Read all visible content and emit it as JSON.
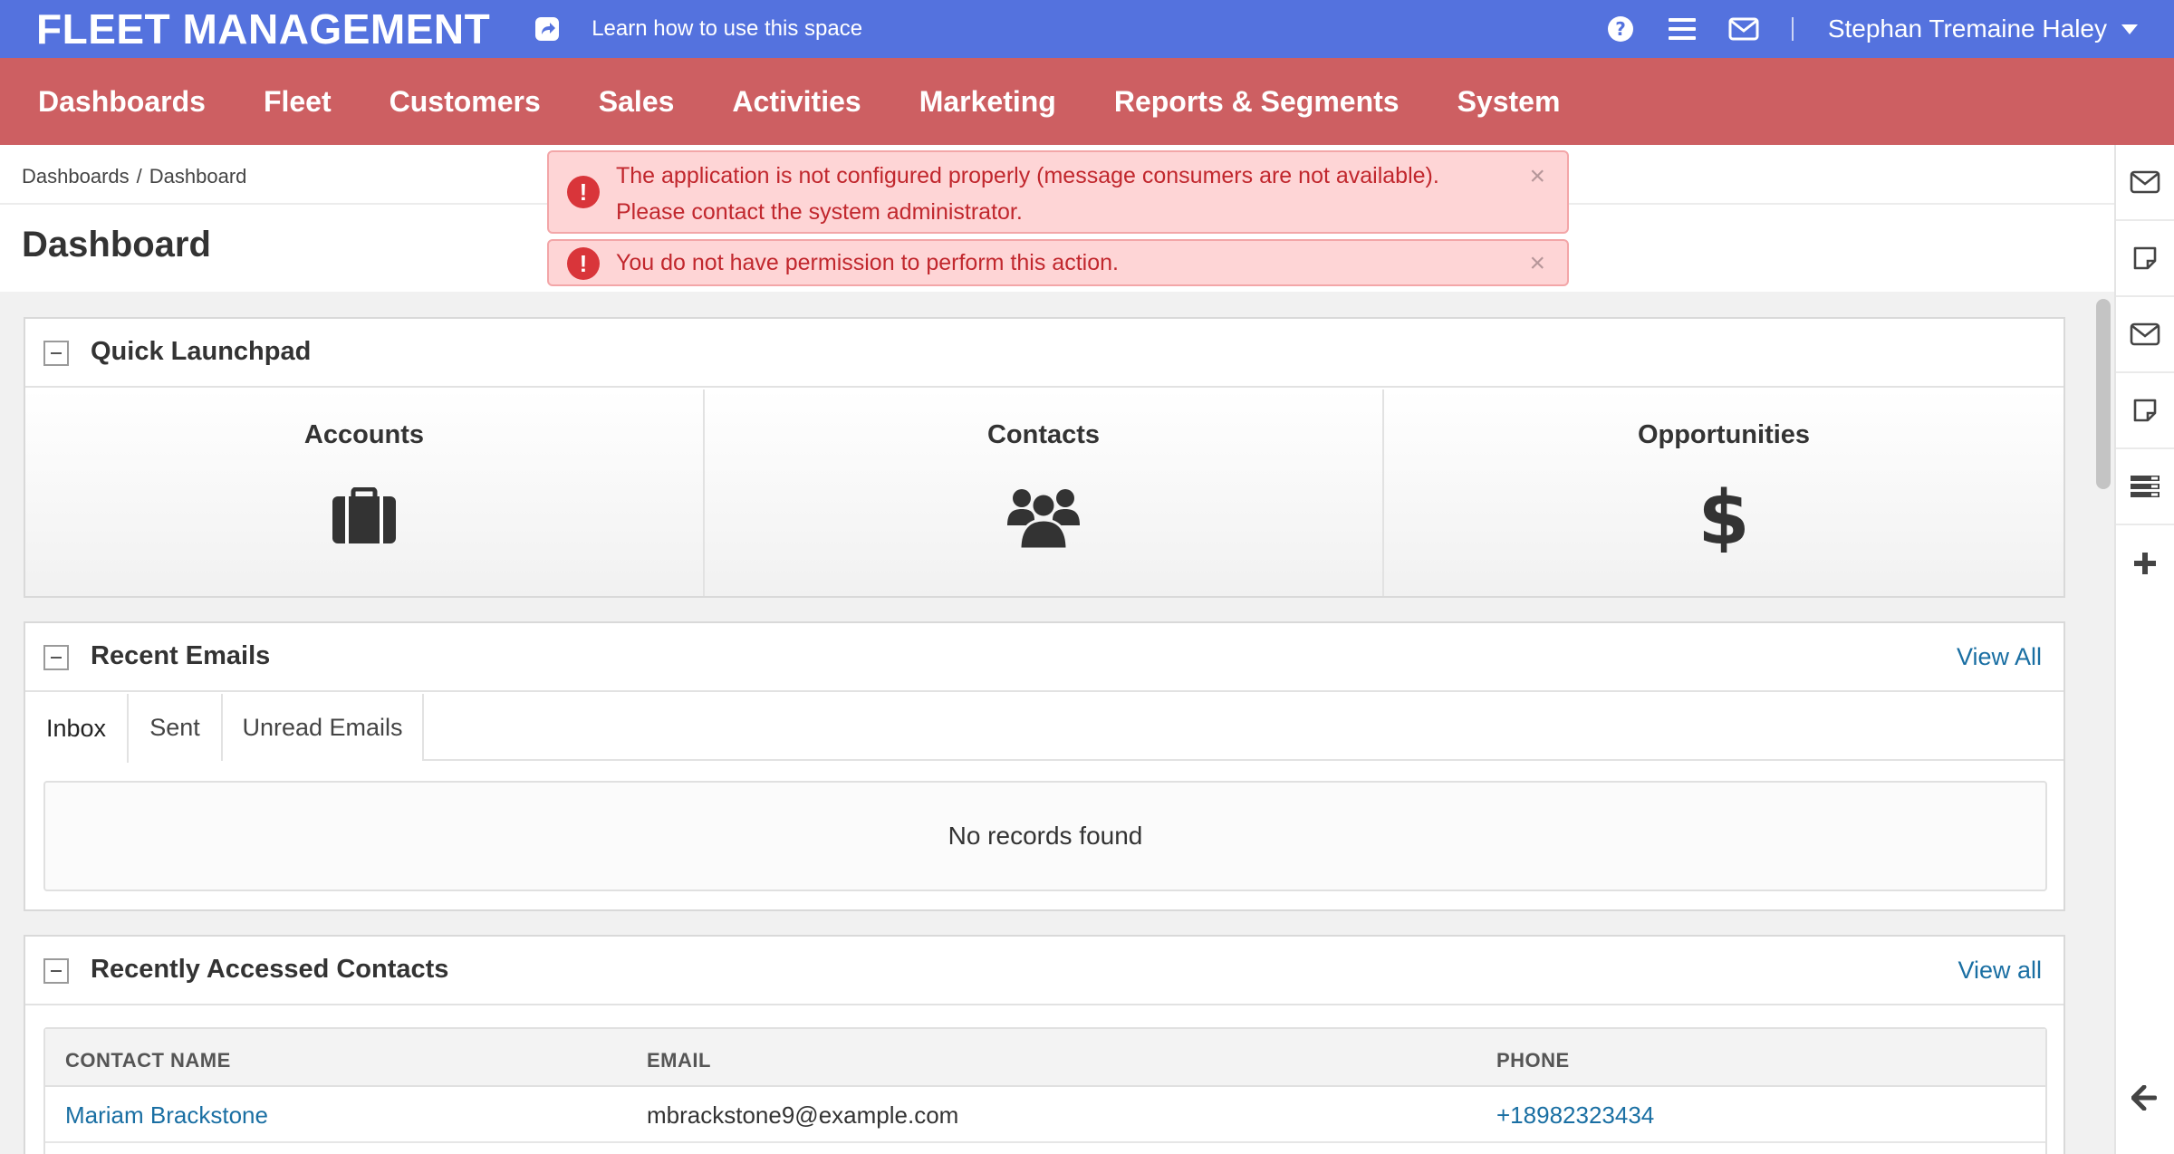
{
  "header": {
    "brand": "FLEET MANAGEMENT",
    "learn_link": "Learn how to use this space",
    "user_name": "Stephan Tremaine Haley",
    "colors": {
      "header_bg": "#5472de",
      "nav_bg": "#cd5f62",
      "link": "#1a6fa3",
      "alert_bg": "#fed5d6",
      "alert_text": "#c1272d"
    }
  },
  "nav": {
    "items": [
      {
        "label": "Dashboards"
      },
      {
        "label": "Fleet"
      },
      {
        "label": "Customers"
      },
      {
        "label": "Sales"
      },
      {
        "label": "Activities"
      },
      {
        "label": "Marketing"
      },
      {
        "label": "Reports & Segments"
      },
      {
        "label": "System"
      }
    ]
  },
  "breadcrumb": {
    "parent": "Dashboards",
    "separator": "/",
    "current": "Dashboard"
  },
  "page": {
    "title": "Dashboard"
  },
  "alerts": [
    {
      "line1": "The application is not configured properly (message consumers are not available).",
      "line2": "Please contact the system administrator.",
      "close": "×"
    },
    {
      "line1": "You do not have permission to perform this action.",
      "close": "×"
    }
  ],
  "quick_launchpad": {
    "title": "Quick Launchpad",
    "tiles": [
      {
        "label": "Accounts",
        "icon": "briefcase-icon"
      },
      {
        "label": "Contacts",
        "icon": "users-icon"
      },
      {
        "label": "Opportunities",
        "icon": "dollar-icon"
      }
    ]
  },
  "recent_emails": {
    "title": "Recent Emails",
    "view_all": "View All",
    "tabs": [
      {
        "label": "Inbox",
        "active": true
      },
      {
        "label": "Sent"
      },
      {
        "label": "Unread Emails"
      }
    ],
    "empty_text": "No records found"
  },
  "recent_contacts": {
    "title": "Recently Accessed Contacts",
    "view_all": "View all",
    "columns": [
      "CONTACT NAME",
      "EMAIL",
      "PHONE"
    ],
    "rows": [
      {
        "name": "Mariam Brackstone",
        "email": "mbrackstone9@example.com",
        "phone": "+18982323434"
      }
    ]
  },
  "sidebar_icons": [
    "envelope-icon",
    "note-icon",
    "envelope-icon",
    "note-icon",
    "list-icon",
    "plus-icon",
    "arrow-left-icon"
  ]
}
